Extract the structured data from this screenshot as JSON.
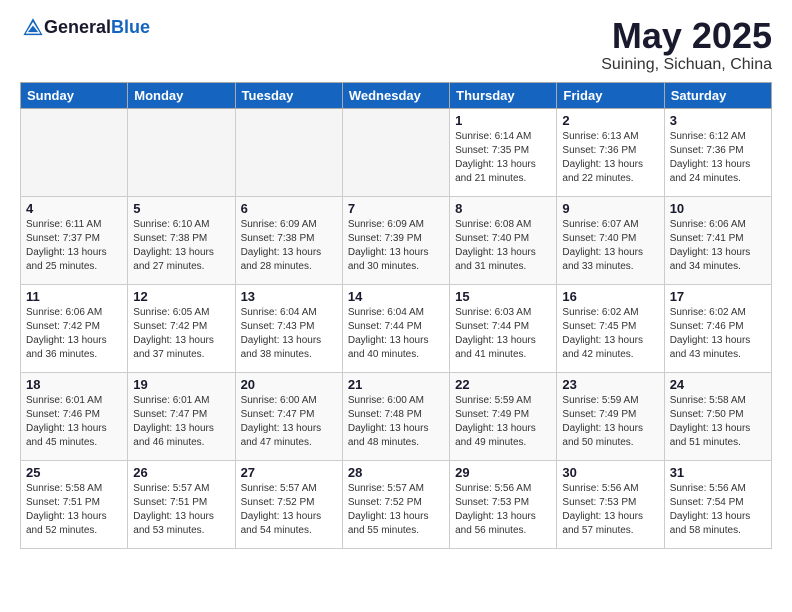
{
  "header": {
    "logo_general": "General",
    "logo_blue": "Blue",
    "title": "May 2025",
    "subtitle": "Suining, Sichuan, China"
  },
  "days_of_week": [
    "Sunday",
    "Monday",
    "Tuesday",
    "Wednesday",
    "Thursday",
    "Friday",
    "Saturday"
  ],
  "weeks": [
    [
      {
        "day": "",
        "empty": true
      },
      {
        "day": "",
        "empty": true
      },
      {
        "day": "",
        "empty": true
      },
      {
        "day": "",
        "empty": true
      },
      {
        "day": "1",
        "sunrise": "Sunrise: 6:14 AM",
        "sunset": "Sunset: 7:35 PM",
        "daylight": "Daylight: 13 hours and 21 minutes."
      },
      {
        "day": "2",
        "sunrise": "Sunrise: 6:13 AM",
        "sunset": "Sunset: 7:36 PM",
        "daylight": "Daylight: 13 hours and 22 minutes."
      },
      {
        "day": "3",
        "sunrise": "Sunrise: 6:12 AM",
        "sunset": "Sunset: 7:36 PM",
        "daylight": "Daylight: 13 hours and 24 minutes."
      }
    ],
    [
      {
        "day": "4",
        "sunrise": "Sunrise: 6:11 AM",
        "sunset": "Sunset: 7:37 PM",
        "daylight": "Daylight: 13 hours and 25 minutes."
      },
      {
        "day": "5",
        "sunrise": "Sunrise: 6:10 AM",
        "sunset": "Sunset: 7:38 PM",
        "daylight": "Daylight: 13 hours and 27 minutes."
      },
      {
        "day": "6",
        "sunrise": "Sunrise: 6:09 AM",
        "sunset": "Sunset: 7:38 PM",
        "daylight": "Daylight: 13 hours and 28 minutes."
      },
      {
        "day": "7",
        "sunrise": "Sunrise: 6:09 AM",
        "sunset": "Sunset: 7:39 PM",
        "daylight": "Daylight: 13 hours and 30 minutes."
      },
      {
        "day": "8",
        "sunrise": "Sunrise: 6:08 AM",
        "sunset": "Sunset: 7:40 PM",
        "daylight": "Daylight: 13 hours and 31 minutes."
      },
      {
        "day": "9",
        "sunrise": "Sunrise: 6:07 AM",
        "sunset": "Sunset: 7:40 PM",
        "daylight": "Daylight: 13 hours and 33 minutes."
      },
      {
        "day": "10",
        "sunrise": "Sunrise: 6:06 AM",
        "sunset": "Sunset: 7:41 PM",
        "daylight": "Daylight: 13 hours and 34 minutes."
      }
    ],
    [
      {
        "day": "11",
        "sunrise": "Sunrise: 6:06 AM",
        "sunset": "Sunset: 7:42 PM",
        "daylight": "Daylight: 13 hours and 36 minutes."
      },
      {
        "day": "12",
        "sunrise": "Sunrise: 6:05 AM",
        "sunset": "Sunset: 7:42 PM",
        "daylight": "Daylight: 13 hours and 37 minutes."
      },
      {
        "day": "13",
        "sunrise": "Sunrise: 6:04 AM",
        "sunset": "Sunset: 7:43 PM",
        "daylight": "Daylight: 13 hours and 38 minutes."
      },
      {
        "day": "14",
        "sunrise": "Sunrise: 6:04 AM",
        "sunset": "Sunset: 7:44 PM",
        "daylight": "Daylight: 13 hours and 40 minutes."
      },
      {
        "day": "15",
        "sunrise": "Sunrise: 6:03 AM",
        "sunset": "Sunset: 7:44 PM",
        "daylight": "Daylight: 13 hours and 41 minutes."
      },
      {
        "day": "16",
        "sunrise": "Sunrise: 6:02 AM",
        "sunset": "Sunset: 7:45 PM",
        "daylight": "Daylight: 13 hours and 42 minutes."
      },
      {
        "day": "17",
        "sunrise": "Sunrise: 6:02 AM",
        "sunset": "Sunset: 7:46 PM",
        "daylight": "Daylight: 13 hours and 43 minutes."
      }
    ],
    [
      {
        "day": "18",
        "sunrise": "Sunrise: 6:01 AM",
        "sunset": "Sunset: 7:46 PM",
        "daylight": "Daylight: 13 hours and 45 minutes."
      },
      {
        "day": "19",
        "sunrise": "Sunrise: 6:01 AM",
        "sunset": "Sunset: 7:47 PM",
        "daylight": "Daylight: 13 hours and 46 minutes."
      },
      {
        "day": "20",
        "sunrise": "Sunrise: 6:00 AM",
        "sunset": "Sunset: 7:47 PM",
        "daylight": "Daylight: 13 hours and 47 minutes."
      },
      {
        "day": "21",
        "sunrise": "Sunrise: 6:00 AM",
        "sunset": "Sunset: 7:48 PM",
        "daylight": "Daylight: 13 hours and 48 minutes."
      },
      {
        "day": "22",
        "sunrise": "Sunrise: 5:59 AM",
        "sunset": "Sunset: 7:49 PM",
        "daylight": "Daylight: 13 hours and 49 minutes."
      },
      {
        "day": "23",
        "sunrise": "Sunrise: 5:59 AM",
        "sunset": "Sunset: 7:49 PM",
        "daylight": "Daylight: 13 hours and 50 minutes."
      },
      {
        "day": "24",
        "sunrise": "Sunrise: 5:58 AM",
        "sunset": "Sunset: 7:50 PM",
        "daylight": "Daylight: 13 hours and 51 minutes."
      }
    ],
    [
      {
        "day": "25",
        "sunrise": "Sunrise: 5:58 AM",
        "sunset": "Sunset: 7:51 PM",
        "daylight": "Daylight: 13 hours and 52 minutes."
      },
      {
        "day": "26",
        "sunrise": "Sunrise: 5:57 AM",
        "sunset": "Sunset: 7:51 PM",
        "daylight": "Daylight: 13 hours and 53 minutes."
      },
      {
        "day": "27",
        "sunrise": "Sunrise: 5:57 AM",
        "sunset": "Sunset: 7:52 PM",
        "daylight": "Daylight: 13 hours and 54 minutes."
      },
      {
        "day": "28",
        "sunrise": "Sunrise: 5:57 AM",
        "sunset": "Sunset: 7:52 PM",
        "daylight": "Daylight: 13 hours and 55 minutes."
      },
      {
        "day": "29",
        "sunrise": "Sunrise: 5:56 AM",
        "sunset": "Sunset: 7:53 PM",
        "daylight": "Daylight: 13 hours and 56 minutes."
      },
      {
        "day": "30",
        "sunrise": "Sunrise: 5:56 AM",
        "sunset": "Sunset: 7:53 PM",
        "daylight": "Daylight: 13 hours and 57 minutes."
      },
      {
        "day": "31",
        "sunrise": "Sunrise: 5:56 AM",
        "sunset": "Sunset: 7:54 PM",
        "daylight": "Daylight: 13 hours and 58 minutes."
      }
    ]
  ]
}
